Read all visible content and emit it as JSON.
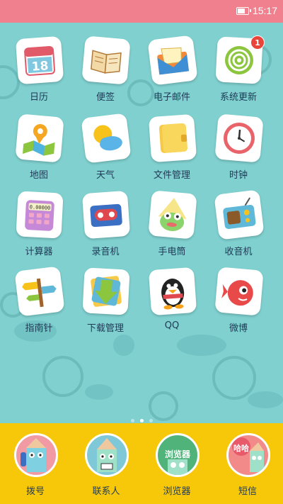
{
  "status_bar": {
    "time": "15:17",
    "battery_level": 0.8
  },
  "apps": [
    {
      "label": "日历",
      "icon": "calendar-icon",
      "date": "18"
    },
    {
      "label": "便签",
      "icon": "notebook-icon"
    },
    {
      "label": "电子邮件",
      "icon": "envelope-icon"
    },
    {
      "label": "系统更新",
      "icon": "spiral-update-icon",
      "badge": "1"
    },
    {
      "label": "地图",
      "icon": "map-pin-icon"
    },
    {
      "label": "天气",
      "icon": "sun-cloud-icon"
    },
    {
      "label": "文件管理",
      "icon": "wallet-folder-icon"
    },
    {
      "label": "时钟",
      "icon": "clock-icon"
    },
    {
      "label": "计算器",
      "icon": "calculator-icon",
      "display": "0.00000"
    },
    {
      "label": "录音机",
      "icon": "cassette-icon"
    },
    {
      "label": "手电筒",
      "icon": "frog-flashlight-icon"
    },
    {
      "label": "收音机",
      "icon": "radio-icon"
    },
    {
      "label": "指南针",
      "icon": "signpost-icon"
    },
    {
      "label": "下载管理",
      "icon": "download-arrow-icon"
    },
    {
      "label": "QQ",
      "icon": "penguin-icon"
    },
    {
      "label": "微博",
      "icon": "weibo-fish-icon"
    }
  ],
  "page_indicator": {
    "count": 3,
    "active": 1
  },
  "dock": [
    {
      "label": "拨号",
      "icon": "phone-character-icon"
    },
    {
      "label": "联系人",
      "icon": "contacts-character-icon"
    },
    {
      "label": "浏览器",
      "icon": "browser-character-icon",
      "tag": "浏览器"
    },
    {
      "label": "短信",
      "icon": "sms-character-icon",
      "tag": "哈哈"
    }
  ],
  "colors": {
    "status_bar": "#f0808e",
    "wallpaper": "#7fd0cf",
    "dock": "#f7c80a",
    "label": "#1f3a55",
    "badge": "#e8443a"
  }
}
